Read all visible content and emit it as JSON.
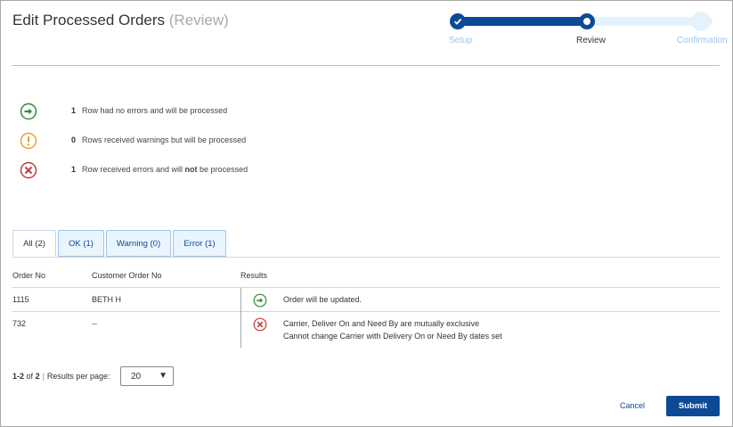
{
  "header": {
    "title": "Edit Processed Orders",
    "subtitle": "(Review)"
  },
  "stepper": {
    "steps": [
      {
        "label": "Setup",
        "state": "complete"
      },
      {
        "label": "Review",
        "state": "current"
      },
      {
        "label": "Confirmation",
        "state": "upcoming"
      }
    ]
  },
  "summary": [
    {
      "icon": "arrow-right-circle-icon",
      "color": "#3a8a3a",
      "count": "1",
      "text_before": "Row had no errors and will be processed",
      "bold": "",
      "text_after": ""
    },
    {
      "icon": "exclamation-circle-icon",
      "color": "#e8a23b",
      "count": "0",
      "text_before": "Rows received warnings but will be processed",
      "bold": "",
      "text_after": ""
    },
    {
      "icon": "x-circle-icon",
      "color": "#c43a3a",
      "count": "1",
      "text_before": "Row received errors and will ",
      "bold": "not",
      "text_after": " be processed"
    }
  ],
  "tabs": [
    {
      "label": "All (2)",
      "active": true
    },
    {
      "label": "OK (1)",
      "active": false
    },
    {
      "label": "Warning (0)",
      "active": false
    },
    {
      "label": "Error (1)",
      "active": false
    }
  ],
  "table": {
    "columns": [
      "Order No",
      "Customer Order No",
      "Results"
    ],
    "rows": [
      {
        "order_no": "1115",
        "customer_order_no": "BETH H",
        "status_icon": "arrow-right-circle-icon",
        "results": [
          "Order will be updated."
        ]
      },
      {
        "order_no": "732",
        "customer_order_no": "--",
        "status_icon": "x-circle-icon",
        "results": [
          "Carrier, Deliver On and Need By are mutually exclusive",
          "Cannot change Carrier with Delivery On or Need By dates set"
        ]
      }
    ]
  },
  "pagination": {
    "range": "1-2",
    "of_label": "of",
    "total": "2",
    "sep": "|",
    "per_page_label": "Results per page:",
    "per_page_value": "20",
    "caret": "▼"
  },
  "actions": {
    "cancel_label": "Cancel",
    "submit_label": "Submit"
  },
  "colors": {
    "primary": "#0d4a96",
    "ok": "#3a8a3a",
    "warning": "#e8a23b",
    "error": "#c43a3a"
  }
}
